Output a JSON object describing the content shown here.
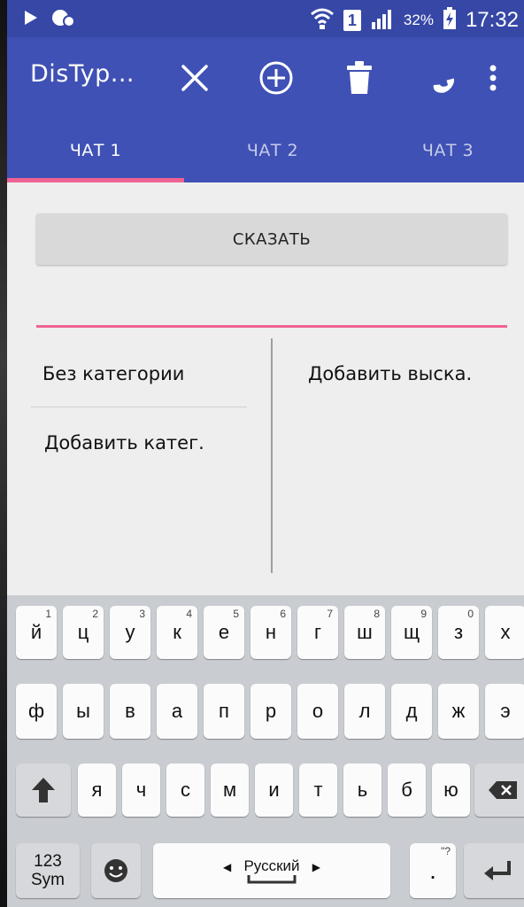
{
  "status_bar": {
    "battery_percent": "32%",
    "time": "17:32",
    "sim_slot": "1",
    "icons": [
      "play-icon",
      "notification-icon",
      "wifi-icon",
      "sim-icon",
      "signal-icon",
      "battery-charging-icon"
    ]
  },
  "app_bar": {
    "title": "DisTyp...",
    "actions": [
      "close-icon",
      "add-circle-icon",
      "trash-icon",
      "phone-icon",
      "overflow-menu-icon"
    ]
  },
  "tabs": [
    {
      "label": "ЧАТ 1",
      "selected": true
    },
    {
      "label": "ЧАТ 2",
      "selected": false
    },
    {
      "label": "ЧАТ 3",
      "selected": false
    }
  ],
  "main": {
    "say_button": "СКАЗАТЬ",
    "categories": [
      "Без категории",
      "Добавить катег."
    ],
    "phrases": [
      "Добавить выска."
    ]
  },
  "keyboard": {
    "row1": [
      {
        "k": "й",
        "h": "1"
      },
      {
        "k": "ц",
        "h": "2"
      },
      {
        "k": "у",
        "h": "3"
      },
      {
        "k": "к",
        "h": "4"
      },
      {
        "k": "е",
        "h": "5"
      },
      {
        "k": "н",
        "h": "6"
      },
      {
        "k": "г",
        "h": "7"
      },
      {
        "k": "ш",
        "h": "8"
      },
      {
        "k": "щ",
        "h": "9"
      },
      {
        "k": "з",
        "h": "0"
      },
      {
        "k": "х",
        "h": ""
      }
    ],
    "row2": [
      "ф",
      "ы",
      "в",
      "а",
      "п",
      "р",
      "о",
      "л",
      "д",
      "ж",
      "э"
    ],
    "row3": [
      "я",
      "ч",
      "с",
      "м",
      "и",
      "т",
      "ь",
      "б",
      "ю"
    ],
    "sym_key_line1": "123",
    "sym_key_line2": "Sym",
    "space_label": "Русский",
    "period_key": ".",
    "period_hint": "\"?"
  },
  "colors": {
    "primary": "#3f51b5",
    "status_bar": "#3647a6",
    "accent": "#f06292",
    "background": "#eeeeee",
    "keyboard": "#c9ccd1"
  }
}
